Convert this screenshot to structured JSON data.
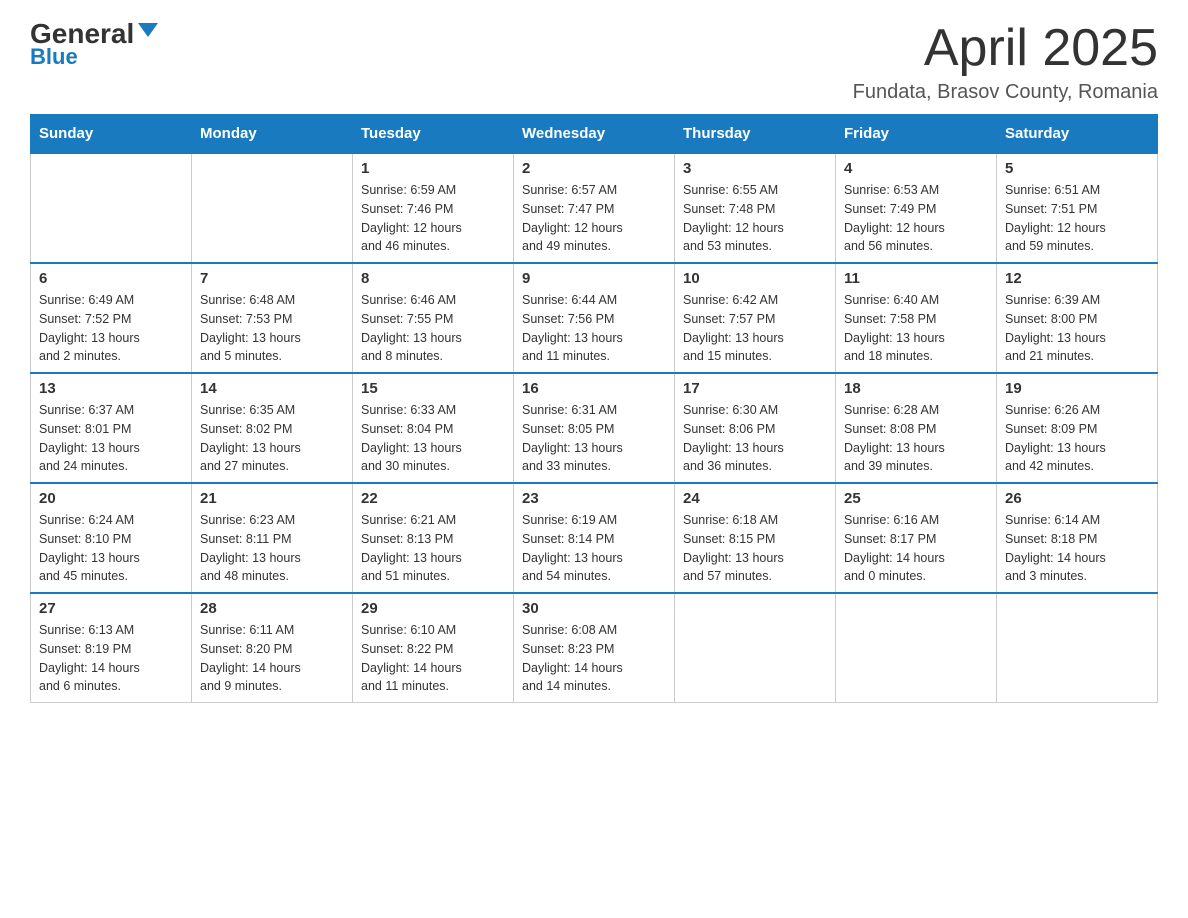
{
  "header": {
    "logo_general": "General",
    "logo_blue": "Blue",
    "title": "April 2025",
    "subtitle": "Fundata, Brasov County, Romania"
  },
  "days_of_week": [
    "Sunday",
    "Monday",
    "Tuesday",
    "Wednesday",
    "Thursday",
    "Friday",
    "Saturday"
  ],
  "weeks": [
    [
      {
        "day": "",
        "info": ""
      },
      {
        "day": "",
        "info": ""
      },
      {
        "day": "1",
        "info": "Sunrise: 6:59 AM\nSunset: 7:46 PM\nDaylight: 12 hours\nand 46 minutes."
      },
      {
        "day": "2",
        "info": "Sunrise: 6:57 AM\nSunset: 7:47 PM\nDaylight: 12 hours\nand 49 minutes."
      },
      {
        "day": "3",
        "info": "Sunrise: 6:55 AM\nSunset: 7:48 PM\nDaylight: 12 hours\nand 53 minutes."
      },
      {
        "day": "4",
        "info": "Sunrise: 6:53 AM\nSunset: 7:49 PM\nDaylight: 12 hours\nand 56 minutes."
      },
      {
        "day": "5",
        "info": "Sunrise: 6:51 AM\nSunset: 7:51 PM\nDaylight: 12 hours\nand 59 minutes."
      }
    ],
    [
      {
        "day": "6",
        "info": "Sunrise: 6:49 AM\nSunset: 7:52 PM\nDaylight: 13 hours\nand 2 minutes."
      },
      {
        "day": "7",
        "info": "Sunrise: 6:48 AM\nSunset: 7:53 PM\nDaylight: 13 hours\nand 5 minutes."
      },
      {
        "day": "8",
        "info": "Sunrise: 6:46 AM\nSunset: 7:55 PM\nDaylight: 13 hours\nand 8 minutes."
      },
      {
        "day": "9",
        "info": "Sunrise: 6:44 AM\nSunset: 7:56 PM\nDaylight: 13 hours\nand 11 minutes."
      },
      {
        "day": "10",
        "info": "Sunrise: 6:42 AM\nSunset: 7:57 PM\nDaylight: 13 hours\nand 15 minutes."
      },
      {
        "day": "11",
        "info": "Sunrise: 6:40 AM\nSunset: 7:58 PM\nDaylight: 13 hours\nand 18 minutes."
      },
      {
        "day": "12",
        "info": "Sunrise: 6:39 AM\nSunset: 8:00 PM\nDaylight: 13 hours\nand 21 minutes."
      }
    ],
    [
      {
        "day": "13",
        "info": "Sunrise: 6:37 AM\nSunset: 8:01 PM\nDaylight: 13 hours\nand 24 minutes."
      },
      {
        "day": "14",
        "info": "Sunrise: 6:35 AM\nSunset: 8:02 PM\nDaylight: 13 hours\nand 27 minutes."
      },
      {
        "day": "15",
        "info": "Sunrise: 6:33 AM\nSunset: 8:04 PM\nDaylight: 13 hours\nand 30 minutes."
      },
      {
        "day": "16",
        "info": "Sunrise: 6:31 AM\nSunset: 8:05 PM\nDaylight: 13 hours\nand 33 minutes."
      },
      {
        "day": "17",
        "info": "Sunrise: 6:30 AM\nSunset: 8:06 PM\nDaylight: 13 hours\nand 36 minutes."
      },
      {
        "day": "18",
        "info": "Sunrise: 6:28 AM\nSunset: 8:08 PM\nDaylight: 13 hours\nand 39 minutes."
      },
      {
        "day": "19",
        "info": "Sunrise: 6:26 AM\nSunset: 8:09 PM\nDaylight: 13 hours\nand 42 minutes."
      }
    ],
    [
      {
        "day": "20",
        "info": "Sunrise: 6:24 AM\nSunset: 8:10 PM\nDaylight: 13 hours\nand 45 minutes."
      },
      {
        "day": "21",
        "info": "Sunrise: 6:23 AM\nSunset: 8:11 PM\nDaylight: 13 hours\nand 48 minutes."
      },
      {
        "day": "22",
        "info": "Sunrise: 6:21 AM\nSunset: 8:13 PM\nDaylight: 13 hours\nand 51 minutes."
      },
      {
        "day": "23",
        "info": "Sunrise: 6:19 AM\nSunset: 8:14 PM\nDaylight: 13 hours\nand 54 minutes."
      },
      {
        "day": "24",
        "info": "Sunrise: 6:18 AM\nSunset: 8:15 PM\nDaylight: 13 hours\nand 57 minutes."
      },
      {
        "day": "25",
        "info": "Sunrise: 6:16 AM\nSunset: 8:17 PM\nDaylight: 14 hours\nand 0 minutes."
      },
      {
        "day": "26",
        "info": "Sunrise: 6:14 AM\nSunset: 8:18 PM\nDaylight: 14 hours\nand 3 minutes."
      }
    ],
    [
      {
        "day": "27",
        "info": "Sunrise: 6:13 AM\nSunset: 8:19 PM\nDaylight: 14 hours\nand 6 minutes."
      },
      {
        "day": "28",
        "info": "Sunrise: 6:11 AM\nSunset: 8:20 PM\nDaylight: 14 hours\nand 9 minutes."
      },
      {
        "day": "29",
        "info": "Sunrise: 6:10 AM\nSunset: 8:22 PM\nDaylight: 14 hours\nand 11 minutes."
      },
      {
        "day": "30",
        "info": "Sunrise: 6:08 AM\nSunset: 8:23 PM\nDaylight: 14 hours\nand 14 minutes."
      },
      {
        "day": "",
        "info": ""
      },
      {
        "day": "",
        "info": ""
      },
      {
        "day": "",
        "info": ""
      }
    ]
  ]
}
